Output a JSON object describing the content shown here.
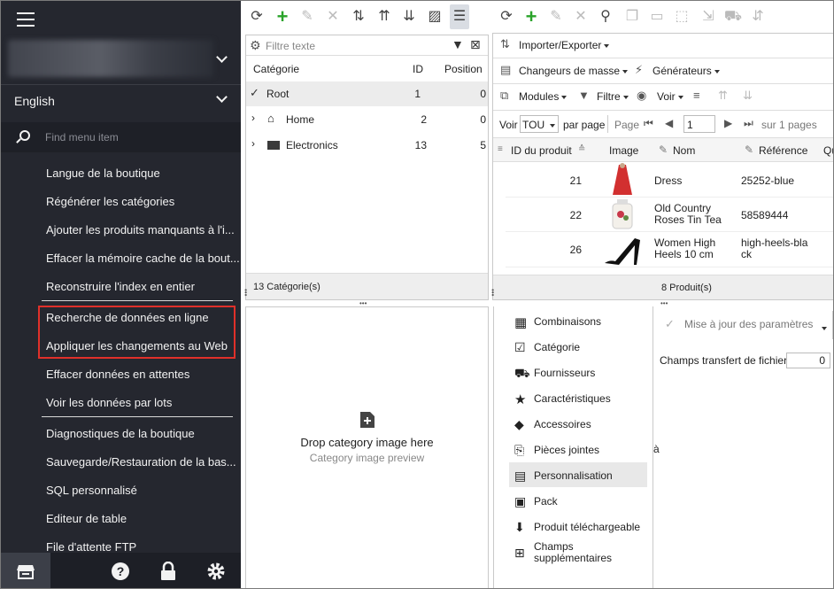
{
  "sidebar": {
    "language": "English",
    "search_placeholder": "Find menu item",
    "items": [
      "Langue de la boutique",
      "Régénérer les catégories",
      "Ajouter les produits manquants à l'i...",
      "Effacer la mémoire cache de la bout...",
      "Reconstruire l'index en entier",
      "Recherche de données en ligne",
      "Appliquer les changements au Web",
      "Effacer données en attentes",
      "Voir les données par lots",
      "Diagnostiques de la boutique",
      "Sauvegarde/Restauration de la bas...",
      "SQL personnalisé",
      "Editeur de table",
      "File d'attente FTP"
    ]
  },
  "categories": {
    "filter_placeholder": "Filtre texte",
    "columns": [
      "Catégorie",
      "ID",
      "Position"
    ],
    "rows": [
      {
        "name": "Root",
        "id": "1",
        "position": "0"
      },
      {
        "name": "Home",
        "id": "2",
        "position": "0"
      },
      {
        "name": "Electronics",
        "id": "13",
        "position": "5"
      }
    ],
    "footer": "13 Catégorie(s)"
  },
  "image_drop": {
    "title": "Drop category image here",
    "subtitle": "Category image preview"
  },
  "products": {
    "import_export": "Importer/Exporter",
    "mass_changers": "Changeurs de masse",
    "generators": "Générateurs",
    "modules": "Modules",
    "filter": "Filtre",
    "view": "Voir",
    "show_label": "Voir",
    "show_value": "TOU",
    "per_page": "par page",
    "page_label": "Page",
    "page_value": "1",
    "pages_of": "sur 1 pages",
    "columns": [
      "ID du produit",
      "Image",
      "Nom",
      "Référence",
      "Qu"
    ],
    "rows": [
      {
        "id": "21",
        "name": "Dress",
        "ref": "25252-blue"
      },
      {
        "id": "22",
        "name": "Old Country Roses Tin Tea",
        "ref": "58589444"
      },
      {
        "id": "26",
        "name": "Women High Heels 10 cm",
        "ref": "high-heels-black"
      }
    ],
    "footer": "8 Produit(s)"
  },
  "tabs": [
    "Combinaisons",
    "Catégorie",
    "Fournisseurs",
    "Caractéristiques",
    "Accessoires",
    "Pièces jointes",
    "Personnalisation",
    "Pack",
    "Produit téléchargeable",
    "Champs supplémentaires"
  ],
  "settings": {
    "update_label": "Mise à jour des paramètres",
    "file_fields_label": "Champs transfert de fichier",
    "file_fields_value": "0",
    "stray_char": "à"
  }
}
